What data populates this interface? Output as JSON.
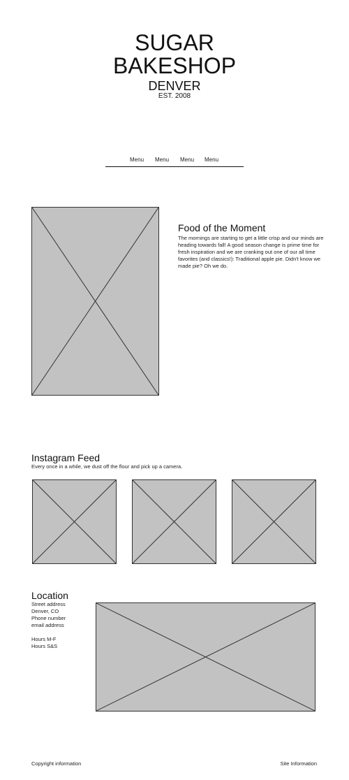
{
  "header": {
    "brand_line1": "SUGAR",
    "brand_line2": "BAKESHOP",
    "city": "DENVER",
    "established": "EST. 2008"
  },
  "nav": {
    "items": [
      "Menu",
      "Menu",
      "Menu",
      "Menu"
    ]
  },
  "feature": {
    "title": "Food of the Moment",
    "text": "The mornings are starting to get a little crisp and our minds are heading towards fall! A good season change is prime time for fresh inspiration and we are cranking out one of our all time favorites (and classics!): Traditional apple pie. Didn't know we made pie? Oh we do."
  },
  "instagram": {
    "title": "Instagram Feed",
    "subtitle": "Every once in a while, we dust off the flour and pick up a camera."
  },
  "location": {
    "title": "Location",
    "street": "Street address",
    "city": "Denver, CO",
    "phone": "Phone number",
    "email": "email address",
    "hours_weekday": "Hours M-F",
    "hours_weekend": "Hours S&S"
  },
  "footer": {
    "copyright": "Copyright information",
    "site_info": "Site Information"
  },
  "colors": {
    "placeholder_fill": "#c2c2c2",
    "line": "#333333"
  }
}
